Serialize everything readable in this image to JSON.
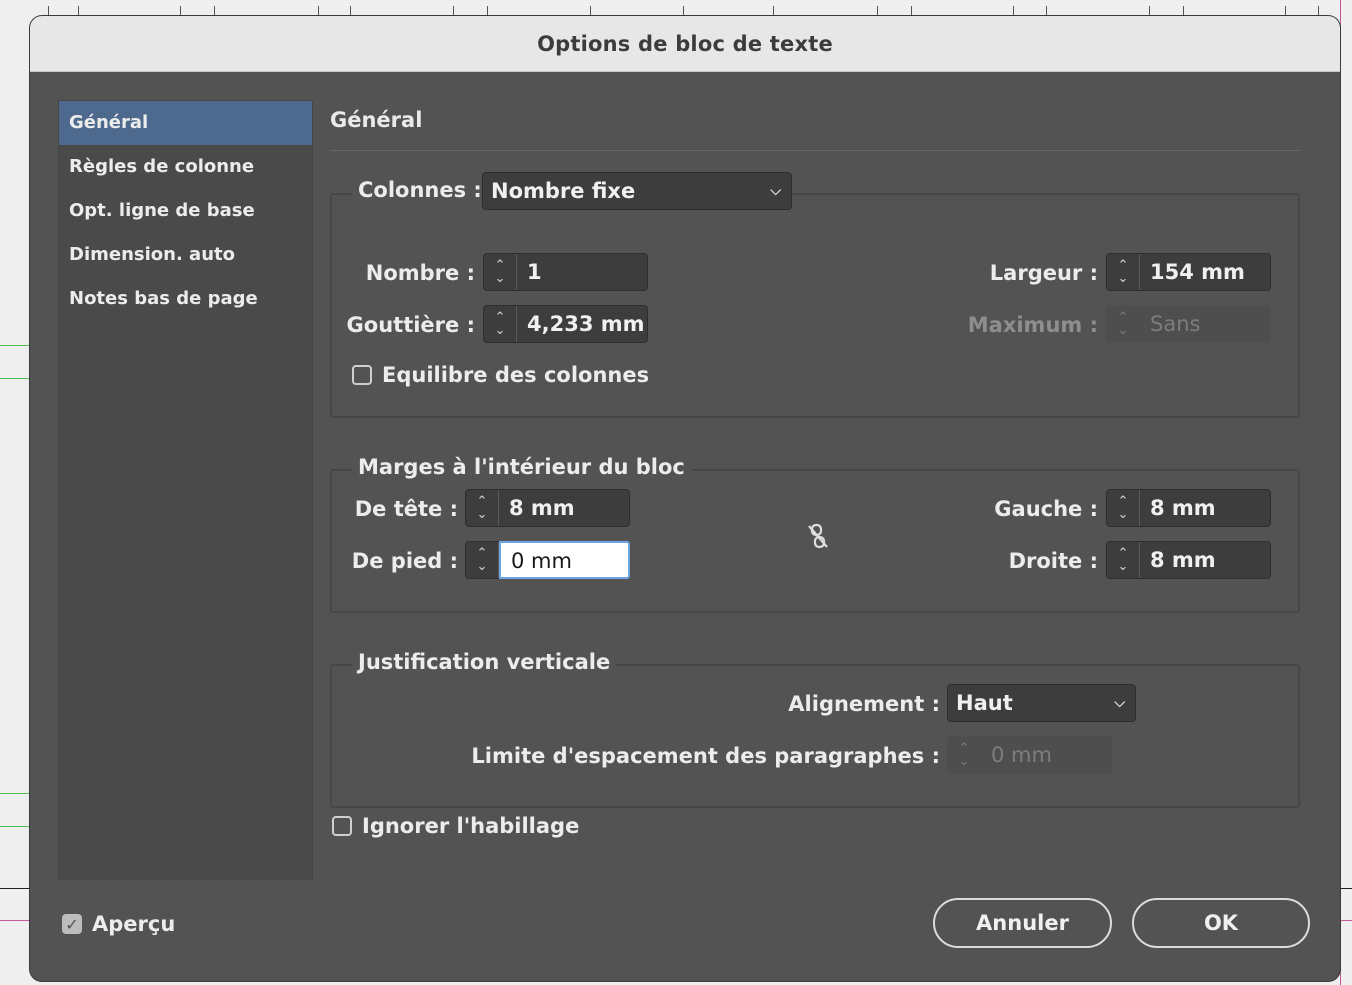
{
  "dialog": {
    "title": "Options de bloc de texte"
  },
  "sidebar": {
    "items": [
      {
        "label": "Général",
        "active": true
      },
      {
        "label": "Règles de colonne"
      },
      {
        "label": "Opt. ligne de base"
      },
      {
        "label": "Dimension. auto"
      },
      {
        "label": "Notes bas de page"
      }
    ]
  },
  "section": {
    "title": "Général"
  },
  "columns": {
    "legend": "Colonnes :",
    "mode": "Nombre fixe",
    "number_label": "Nombre :",
    "number_value": "1",
    "gutter_label": "Gouttière :",
    "gutter_value": "4,233 mm",
    "width_label": "Largeur :",
    "width_value": "154 mm",
    "max_label": "Maximum :",
    "max_value": "Sans",
    "balance_label": "Equilibre des colonnes",
    "balance_checked": false
  },
  "inset": {
    "legend": "Marges à l'intérieur du bloc",
    "top_label": "De tête :",
    "top_value": "8 mm",
    "bottom_label": "De pied :",
    "bottom_value": "0 mm",
    "left_label": "Gauche :",
    "left_value": "8 mm",
    "right_label": "Droite :",
    "right_value": "8 mm",
    "link_icon": "broken-chain-icon"
  },
  "vertical": {
    "legend": "Justification verticale",
    "align_label": "Alignement :",
    "align_value": "Haut",
    "limit_label": "Limite d'espacement des paragraphes :",
    "limit_value": "0 mm"
  },
  "ignore_wrap": {
    "label": "Ignorer l'habillage",
    "checked": false
  },
  "preview": {
    "label": "Aperçu",
    "checked": true
  },
  "buttons": {
    "cancel": "Annuler",
    "ok": "OK"
  },
  "colors": {
    "dialog_bg": "#535353",
    "selection": "#4d6a8e",
    "focus_ring": "#6aa6e0",
    "guide_green": "#4fc04f",
    "guide_magenta": "#c75a9a"
  }
}
